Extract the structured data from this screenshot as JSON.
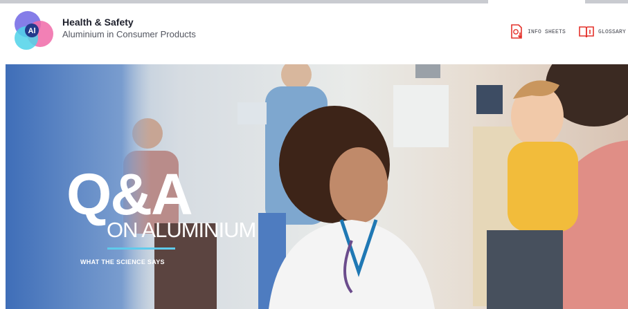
{
  "header": {
    "title": "Health & Safety",
    "subtitle": "Aluminium in Consumer Products",
    "logo_text": "Al",
    "accent_color": "#e4322b"
  },
  "nav": {
    "info_sheets": {
      "label": "INFO SHEETS",
      "icon": "download-document-icon"
    },
    "glossary": {
      "label": "GLOSSARY",
      "icon": "book-icon"
    }
  },
  "hero": {
    "headline": "Q&A",
    "subheadline": "ON ALUMINIUM",
    "tagline": "WHAT THE SCIENCE SAYS",
    "underline_color": "#5ecbec"
  }
}
